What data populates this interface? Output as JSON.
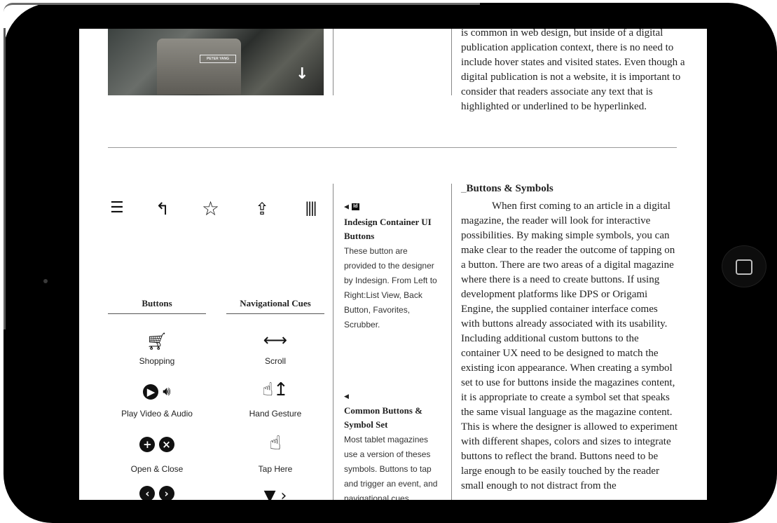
{
  "device": {
    "home_button_icon": "square-icon"
  },
  "top_section": {
    "photo_credit": "PETER YANG",
    "paragraph": "is common in web design, but inside of a digital publication application context, there is no need to include hover states and visited states. Even though a digital publication is not a website, it is important to consider that readers associate any text that is highlighted or underlined to be hyperlinked."
  },
  "toolbar_icons": [
    "list-view-icon",
    "back-icon",
    "favorites-star-icon",
    "share-icon",
    "scrubber-icon"
  ],
  "buttons_column": {
    "heading": "Buttons",
    "items": [
      {
        "icon": "shopping-cart-icon",
        "label": "Shopping"
      },
      {
        "icon": "play-audio-icon",
        "label": "Play Video & Audio"
      },
      {
        "icon": "open-close-icon",
        "label": "Open & Close"
      }
    ]
  },
  "nav_column": {
    "heading": "Navigational Cues",
    "items": [
      {
        "icon": "scroll-arrows-icon",
        "label": "Scroll"
      },
      {
        "icon": "hand-gesture-icon",
        "label": "Hand Gesture"
      },
      {
        "icon": "tap-here-icon",
        "label": "Tap Here"
      }
    ]
  },
  "sidebar": {
    "note1": {
      "badge": "Id",
      "title": "Indesign Container UI Buttons",
      "body": "These button are provided to the designer by Indesign. From Left to Right:List View, Back Button, Favorites, Scrubber."
    },
    "note2": {
      "title": "Common Buttons & Symbol Set",
      "body": "Most tablet magazines use a version of theses symbols. Buttons to tap and trigger an event, and navigational cues"
    }
  },
  "article": {
    "title_prefix": "_",
    "title": "Buttons & Symbols",
    "paragraph": "When first coming to an article in a digital magazine, the reader will look for interactive possibilities. By making simple symbols, you can make clear to the reader the outcome of tapping on a button. There are two areas of a digital magazine where there is a need to create buttons. If using development platforms like DPS or Origami Engine, the supplied container interface comes with buttons already associated with its usability. Including additional custom buttons to the container UX need to be designed to match the existing icon appearance. When creating a symbol set to use for buttons inside the magazines content, it is appropriate to create a symbol set that speaks the same visual language as the magazine content. This is where the designer is allowed to experiment with different shapes, colors and sizes to integrate buttons to reflect the brand. Buttons need to be large enough to be easily touched by the reader small enough to not distract from the"
  }
}
